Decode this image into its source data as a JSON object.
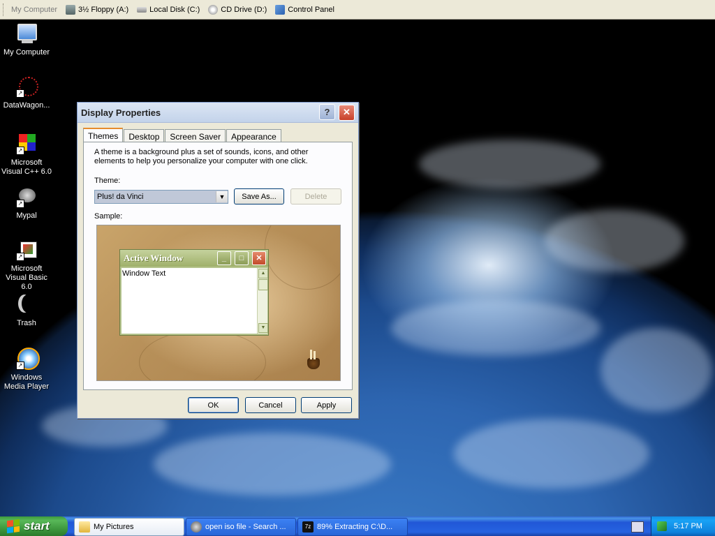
{
  "quicklaunch": {
    "items": [
      {
        "label": "My Computer",
        "icon": "computer-icon"
      },
      {
        "label": "3½ Floppy (A:)",
        "icon": "floppy-icon"
      },
      {
        "label": "Local Disk (C:)",
        "icon": "hard-disk-icon"
      },
      {
        "label": "CD Drive (D:)",
        "icon": "cd-drive-icon"
      },
      {
        "label": "Control Panel",
        "icon": "control-panel-icon"
      }
    ]
  },
  "desktop_icons": [
    {
      "label": "My Computer",
      "icon": "computer-icon"
    },
    {
      "label": "DataWagon...",
      "icon": "datawagon-icon"
    },
    {
      "label": "Microsoft Visual C++ 6.0",
      "icon": "visual-cpp-icon"
    },
    {
      "label": "Mypal",
      "icon": "mypal-icon"
    },
    {
      "label": "Microsoft Visual Basic 6.0",
      "icon": "visual-basic-icon"
    },
    {
      "label": "Trash",
      "icon": "trash-icon"
    },
    {
      "label": "Windows Media Player",
      "icon": "media-player-icon"
    }
  ],
  "dialog": {
    "title": "Display Properties",
    "help_button": "?",
    "close_button": "✕",
    "tabs": [
      "Themes",
      "Desktop",
      "Screen Saver",
      "Appearance"
    ],
    "active_tab": "Themes",
    "description": "A theme is a background plus a set of sounds, icons, and other elements to help you personalize your computer with one click.",
    "theme_label": "Theme:",
    "theme_value": "Plus! da Vinci",
    "save_as_label": "Save As...",
    "delete_label": "Delete",
    "sample_label": "Sample:",
    "sample_window": {
      "title": "Active Window",
      "body_text": "Window Text"
    },
    "ok_label": "OK",
    "cancel_label": "Cancel",
    "apply_label": "Apply"
  },
  "taskbar": {
    "start_label": "start",
    "tasks": [
      {
        "label": "My Pictures",
        "icon": "folder-icon",
        "active": true
      },
      {
        "label": "open iso file - Search ...",
        "icon": "search-browser-icon",
        "active": false
      },
      {
        "label": "89% Extracting C:\\D...",
        "icon": "7zip-icon",
        "active": false
      }
    ],
    "clock": "5:17 PM"
  },
  "colors": {
    "taskbar_blue": "#2663e0",
    "start_green": "#3a933a",
    "dialog_face": "#ece9d8",
    "active_tab_accent": "#e68b2c"
  }
}
